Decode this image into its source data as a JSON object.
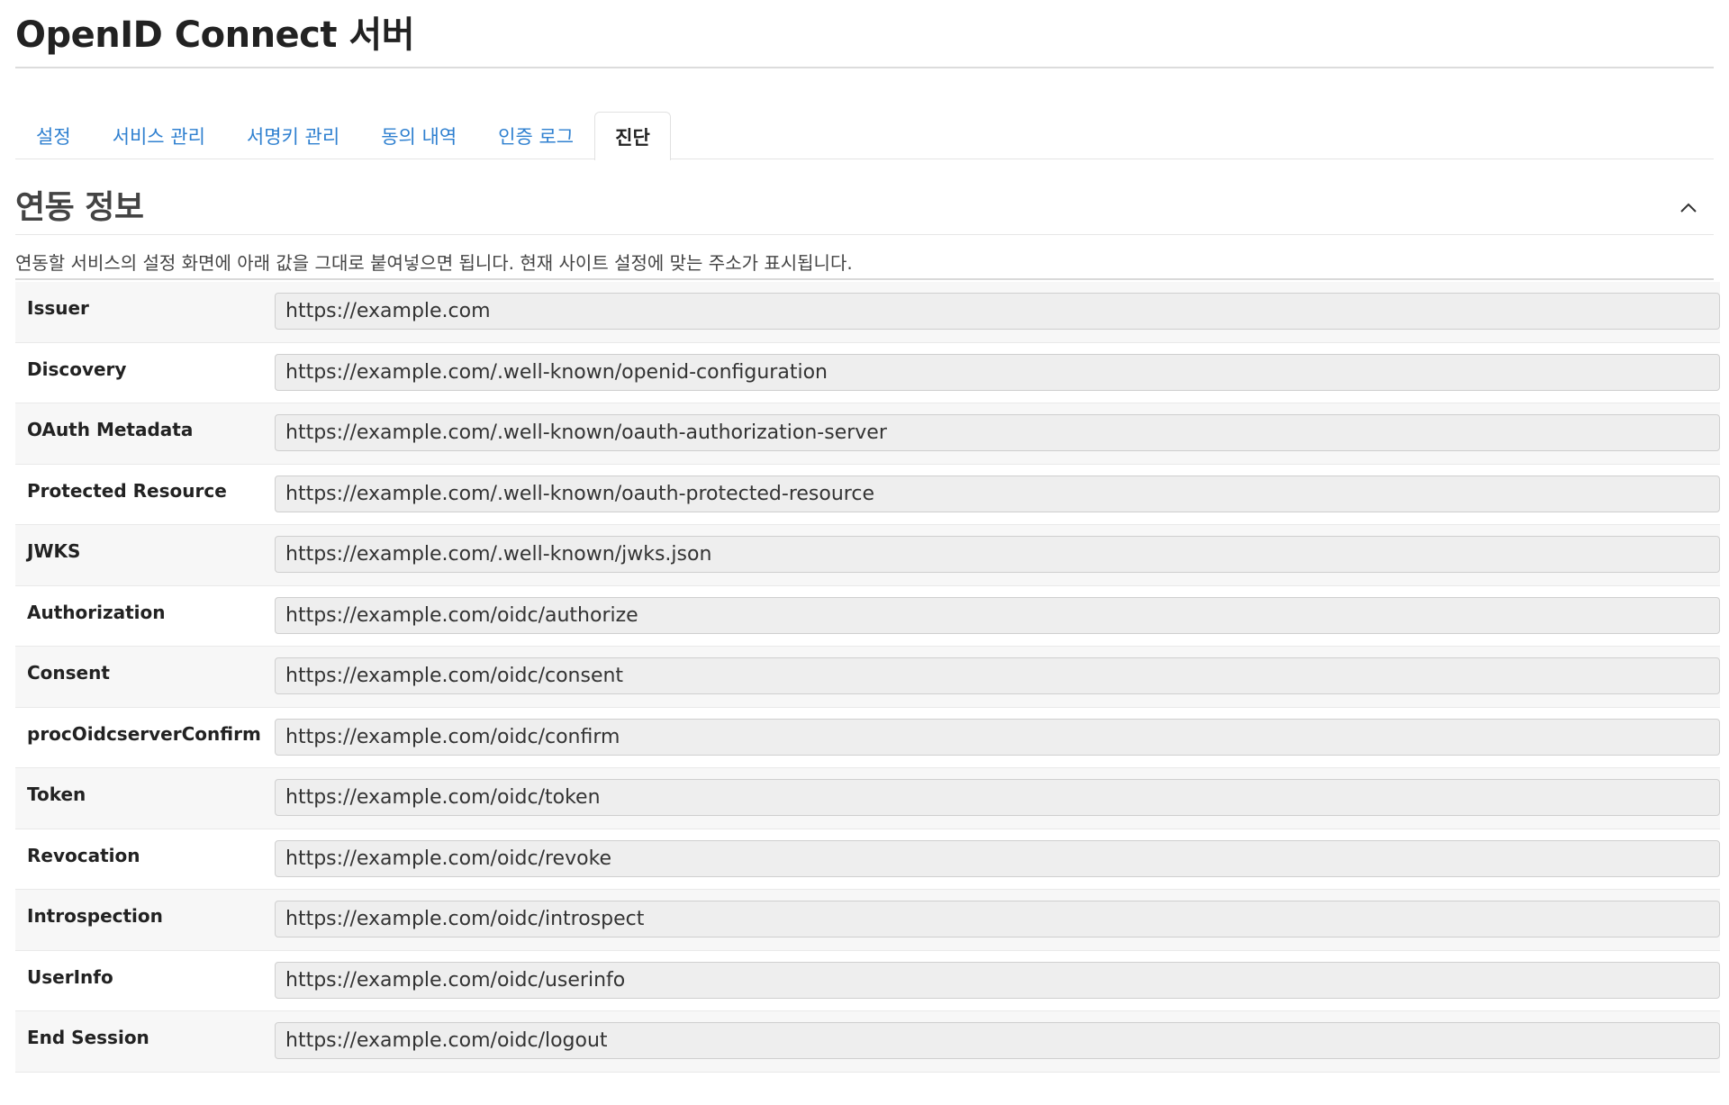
{
  "page": {
    "title": "OpenID Connect 서버"
  },
  "tabs": [
    {
      "label": "설정",
      "active": false
    },
    {
      "label": "서비스 관리",
      "active": false
    },
    {
      "label": "서명키 관리",
      "active": false
    },
    {
      "label": "동의 내역",
      "active": false
    },
    {
      "label": "인증 로그",
      "active": false
    },
    {
      "label": "진단",
      "active": true
    }
  ],
  "section": {
    "title": "연동 정보",
    "description": "연동할 서비스의 설정 화면에 아래 값을 그대로 붙여넣으면 됩니다. 현재 사이트 설정에 맞는 주소가 표시됩니다.",
    "collapse_icon": "chevron-up-icon"
  },
  "endpoints": [
    {
      "label": "Issuer",
      "value": "https://example.com"
    },
    {
      "label": "Discovery",
      "value": "https://example.com/.well-known/openid-configuration"
    },
    {
      "label": "OAuth Metadata",
      "value": "https://example.com/.well-known/oauth-authorization-server"
    },
    {
      "label": "Protected Resource",
      "value": "https://example.com/.well-known/oauth-protected-resource"
    },
    {
      "label": "JWKS",
      "value": "https://example.com/.well-known/jwks.json"
    },
    {
      "label": "Authorization",
      "value": "https://example.com/oidc/authorize"
    },
    {
      "label": "Consent",
      "value": "https://example.com/oidc/consent"
    },
    {
      "label": "procOidcserverConfirm",
      "value": "https://example.com/oidc/confirm"
    },
    {
      "label": "Token",
      "value": "https://example.com/oidc/token"
    },
    {
      "label": "Revocation",
      "value": "https://example.com/oidc/revoke"
    },
    {
      "label": "Introspection",
      "value": "https://example.com/oidc/introspect"
    },
    {
      "label": "UserInfo",
      "value": "https://example.com/oidc/userinfo"
    },
    {
      "label": "End Session",
      "value": "https://example.com/oidc/logout"
    }
  ],
  "colors": {
    "link": "#2f80d0",
    "text": "#222222",
    "input_bg": "#eeeeee"
  }
}
